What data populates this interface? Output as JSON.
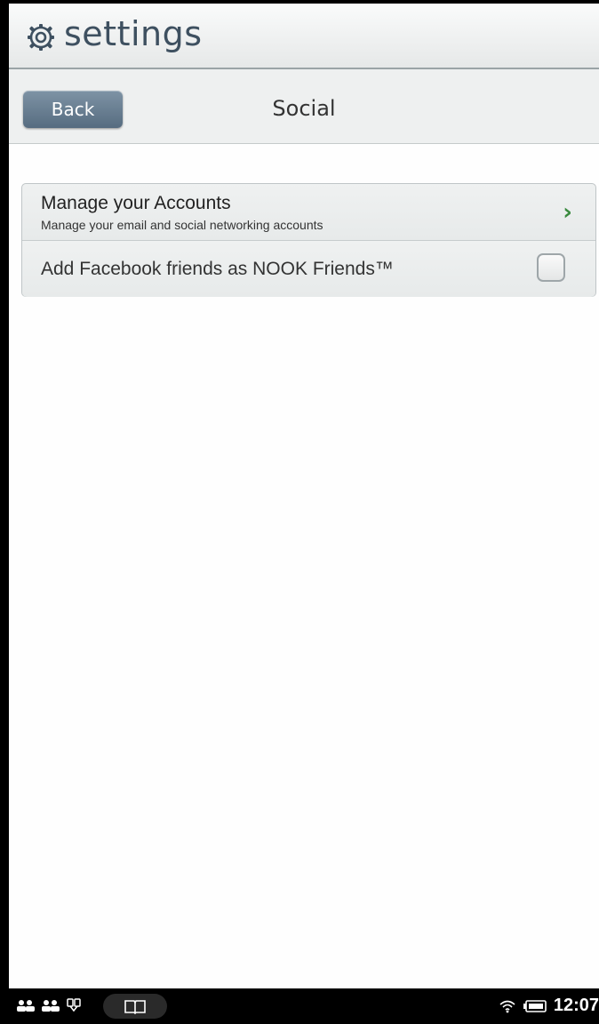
{
  "header": {
    "title": "settings",
    "icon": "gear-icon"
  },
  "subbar": {
    "back_label": "Back",
    "title": "Social"
  },
  "list": {
    "items": [
      {
        "title": "Manage your Accounts",
        "subtitle": "Manage your email and social networking accounts",
        "accessory": "chevron-right-icon",
        "accessory_color": "#3a8a3f"
      },
      {
        "title": "Add Facebook friends as NOOK Friends™",
        "accessory": "checkbox",
        "checked": false
      }
    ]
  },
  "statusbar": {
    "time": "12:07",
    "left_icons": [
      "people-icon",
      "people-icon",
      "notification-icon"
    ],
    "center_icon": "book-icon",
    "right_icons": [
      "wifi-icon",
      "battery-icon"
    ]
  }
}
